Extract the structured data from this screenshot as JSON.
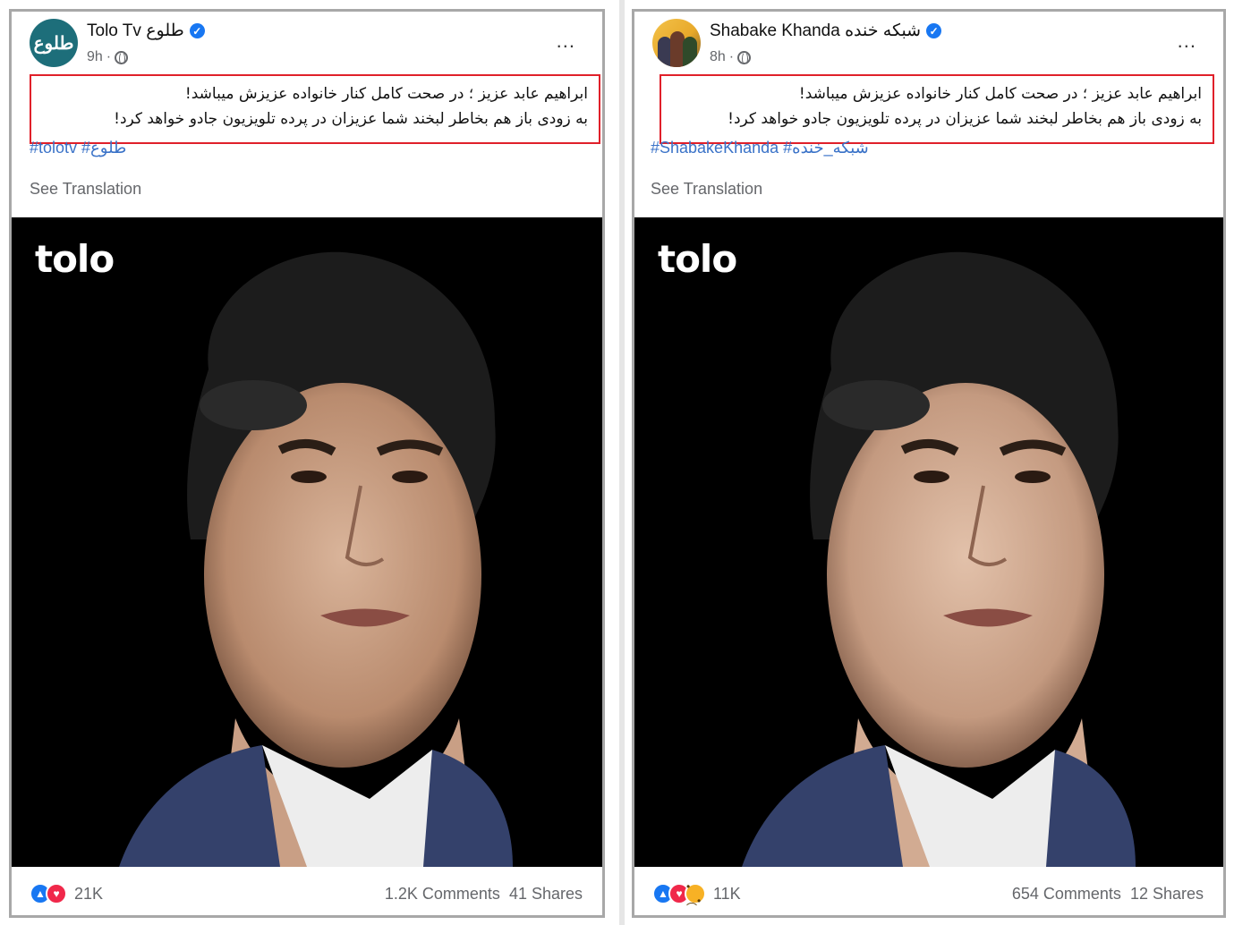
{
  "posts": [
    {
      "page_name": "Tolo Tv طلوع",
      "avatar_text": "طلوع",
      "time": "9h",
      "caption_line1": "ابراهیم عابد عزیز ؛ در صحت کامل کنار خانواده عزیزش میباشد!",
      "caption_line2": "به زودی باز هم بخاطر لبخند شما عزیزان در پرده تلویزیون جادو خواهد کرد!",
      "hashtags": "#tolotv #طلوع",
      "see_translation": "See Translation",
      "logo_text": "tolo",
      "reaction_count": "21K",
      "comments": "1.2K Comments",
      "shares": "41 Shares"
    },
    {
      "page_name": "Shabake Khanda شبکه خنده",
      "time": "8h",
      "caption_line1": "ابراهیم عابد عزیز ؛ در صحت کامل کنار خانواده عزیزش میباشد!",
      "caption_line2": "به زودی باز هم بخاطر لبخند شما عزیزان در پرده تلویزیون جادو خواهد کرد!",
      "hashtags": "#ShabakeKhanda #شبکه_خنده",
      "see_translation": "See Translation",
      "logo_text": "tolo",
      "reaction_count": "11K",
      "comments": "654 Comments",
      "shares": "12 Shares"
    }
  ],
  "icons": {
    "more": "...",
    "verified": "✓",
    "like": "👍",
    "love": "♥",
    "sad": "😢"
  },
  "colors": {
    "highlight_box": "#e0202a",
    "hashtag": "#3b73c8",
    "verified": "#1877f2"
  }
}
